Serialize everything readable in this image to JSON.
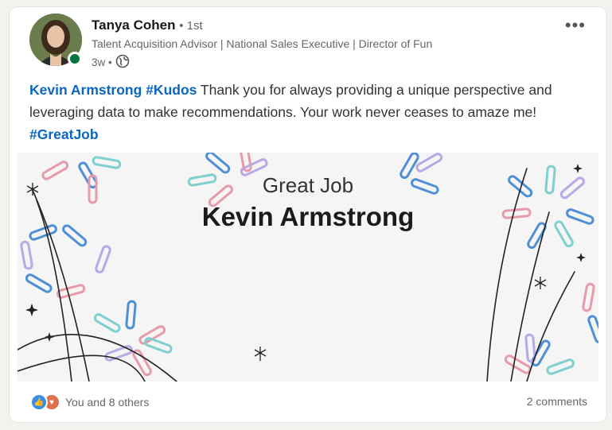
{
  "author": {
    "name": "Tanya Cohen",
    "degree": "• 1st",
    "headline": "Talent Acquisition Advisor | National Sales Executive | Director of Fun",
    "time": "3w •"
  },
  "post": {
    "mention": "Kevin Armstrong",
    "hashtag1": "#Kudos",
    "body": " Thank you for always providing a unique perspective and leveraging data to make recommendations. Your work never ceases to amaze me! ",
    "hashtag2": "#GreatJob"
  },
  "banner": {
    "subtitle": "Great Job",
    "recipient": "Kevin Armstrong"
  },
  "social": {
    "reactions": "You and 8 others",
    "comments": "2 comments"
  },
  "icons": {
    "more": "more-options-icon",
    "visibility": "globe-icon",
    "like": "like-reaction-icon",
    "love": "love-reaction-icon"
  },
  "colors": {
    "link": "#0a66c2",
    "presence": "#057642",
    "paperclip_blue": "#4f8fd6",
    "paperclip_pink": "#e79aa9",
    "paperclip_teal": "#7fcfcf",
    "paperclip_lilac": "#b8a9e6"
  }
}
